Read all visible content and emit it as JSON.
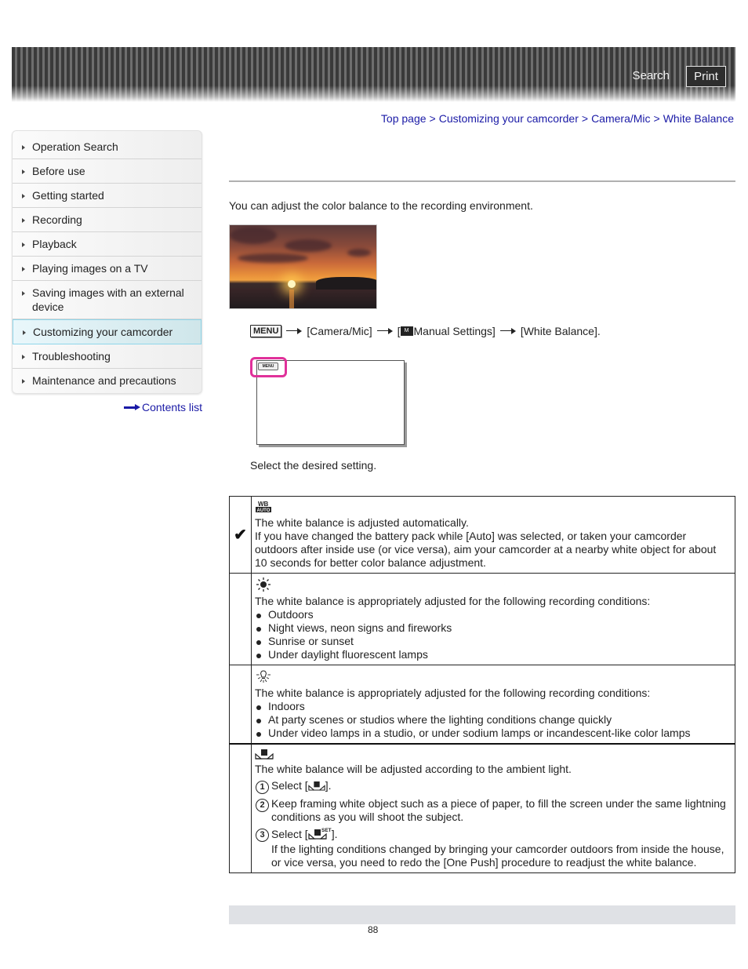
{
  "header": {
    "search_label": "Search",
    "print_label": "Print"
  },
  "breadcrumb": [
    {
      "label": "Top page"
    },
    {
      "label": "Customizing your camcorder"
    },
    {
      "label": "Camera/Mic"
    },
    {
      "label": "White Balance"
    }
  ],
  "breadcrumb_separator": ">",
  "sidebar": {
    "items": [
      {
        "label": "Operation Search",
        "active": false
      },
      {
        "label": "Before use",
        "active": false
      },
      {
        "label": "Getting started",
        "active": false
      },
      {
        "label": "Recording",
        "active": false
      },
      {
        "label": "Playback",
        "active": false
      },
      {
        "label": "Playing images on a TV",
        "active": false
      },
      {
        "label": "Saving images with an external device",
        "active": false
      },
      {
        "label": "Customizing your camcorder",
        "active": true
      },
      {
        "label": "Troubleshooting",
        "active": false
      },
      {
        "label": "Maintenance and precautions",
        "active": false
      }
    ],
    "contents_link": "Contents list"
  },
  "main": {
    "intro": "You can adjust the color balance to the recording environment.",
    "photo_alt": "sunset-over-sea",
    "menu_path": {
      "menu_button": "MENU",
      "step1": "[Camera/Mic]",
      "step2_prefix": "[",
      "step2_icon": "Manual Settings icon",
      "step2_label": "Manual Settings]",
      "step3": "[White Balance]."
    },
    "screen_menu_label": "MENU",
    "select_text": "Select the desired setting.",
    "settings": [
      {
        "icon": "wb-auto-icon",
        "selected": true,
        "description": "The white balance is adjusted automatically.",
        "note": "If you have changed the battery pack while [Auto] was selected, or taken your camcorder outdoors after inside use (or vice versa), aim your camcorder at a nearby white object for about 10 seconds for better color balance adjustment."
      },
      {
        "icon": "outdoor-sun-icon",
        "selected": false,
        "description": "The white balance is appropriately adjusted for the following recording conditions:",
        "bullets": [
          "Outdoors",
          "Night views, neon signs and fireworks",
          "Sunrise or sunset",
          "Under daylight fluorescent lamps"
        ]
      },
      {
        "icon": "indoor-bulb-icon",
        "selected": false,
        "description": "The white balance is appropriately adjusted for the following recording conditions:",
        "bullets": [
          "Indoors",
          "At party scenes or studios where the lighting conditions change quickly",
          "Under video lamps in a studio, or under sodium lamps or incandescent-like color lamps"
        ]
      },
      {
        "icon": "one-push-icon",
        "selected": false,
        "description": "The white balance will be adjusted according to the ambient light.",
        "steps": [
          {
            "num": "1",
            "text_before": "Select [",
            "text_after": "]."
          },
          {
            "num": "2",
            "text": "Keep framing white object such as a piece of paper, to fill the screen under the same lightning conditions as you will shoot the subject."
          },
          {
            "num": "3",
            "text_before": "Select [",
            "text_after": "].",
            "icon_sup": "SET"
          }
        ],
        "note": "If the lighting conditions changed by bringing your camcorder outdoors from inside the house, or vice versa, you need to redo the [One Push] procedure to readjust the white balance."
      }
    ]
  },
  "footer": {
    "page_number": "88"
  },
  "colors": {
    "link": "#1a1aa6",
    "highlight_ring": "#e0319a",
    "active_sidebar_border": "#8fd6ea",
    "footer_bar": "#dfe1e5"
  }
}
